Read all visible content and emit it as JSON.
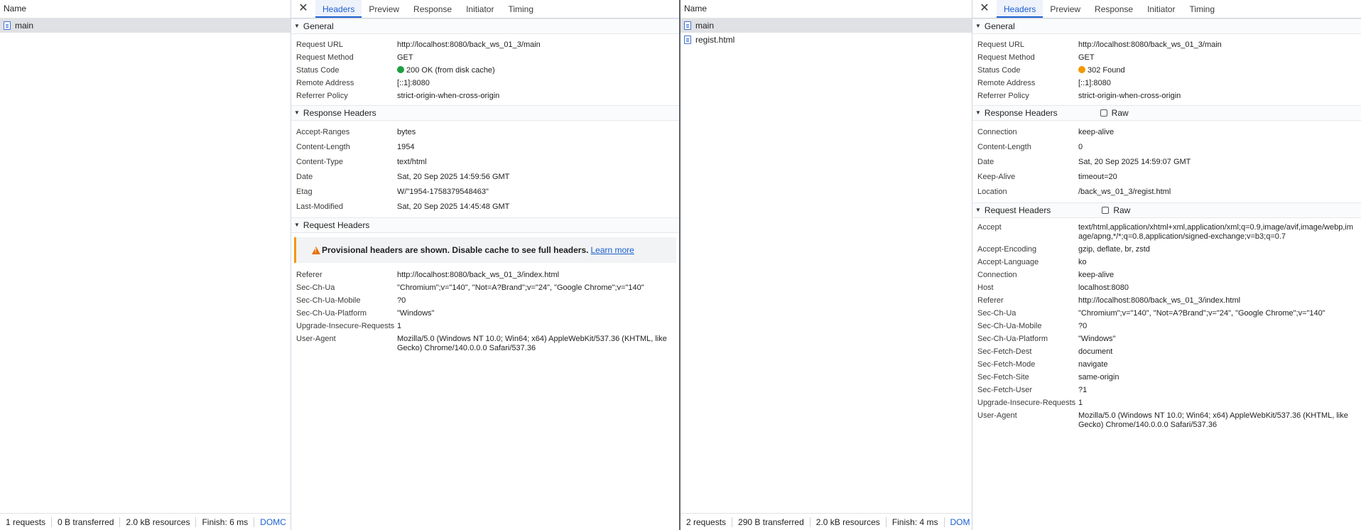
{
  "left": {
    "list_header": "Name",
    "items": [
      "main"
    ],
    "status": [
      "1 requests",
      "0 B transferred",
      "2.0 kB resources",
      "Finish: 6 ms",
      "DOMC"
    ],
    "tabs": [
      "Headers",
      "Preview",
      "Response",
      "Initiator",
      "Timing"
    ],
    "general": {
      "title": "General",
      "rows": [
        {
          "k": "Request URL",
          "v": "http://localhost:8080/back_ws_01_3/main"
        },
        {
          "k": "Request Method",
          "v": "GET"
        },
        {
          "k": "Status Code",
          "v": "200 OK (from disk cache)"
        },
        {
          "k": "Remote Address",
          "v": "[::1]:8080"
        },
        {
          "k": "Referrer Policy",
          "v": "strict-origin-when-cross-origin"
        }
      ]
    },
    "response_headers": {
      "title": "Response Headers",
      "rows": [
        {
          "k": "Accept-Ranges",
          "v": "bytes"
        },
        {
          "k": "Content-Length",
          "v": "1954"
        },
        {
          "k": "Content-Type",
          "v": "text/html"
        },
        {
          "k": "Date",
          "v": "Sat, 20 Sep 2025 14:59:56 GMT"
        },
        {
          "k": "Etag",
          "v": "W/\"1954-1758379548463\""
        },
        {
          "k": "Last-Modified",
          "v": "Sat, 20 Sep 2025 14:45:48 GMT"
        }
      ]
    },
    "request_headers": {
      "title": "Request Headers",
      "warning": "Provisional headers are shown. Disable cache to see full headers.",
      "learn_more": "Learn more",
      "rows": [
        {
          "k": "Referer",
          "v": "http://localhost:8080/back_ws_01_3/index.html"
        },
        {
          "k": "Sec-Ch-Ua",
          "v": "\"Chromium\";v=\"140\", \"Not=A?Brand\";v=\"24\", \"Google Chrome\";v=\"140\""
        },
        {
          "k": "Sec-Ch-Ua-Mobile",
          "v": "?0"
        },
        {
          "k": "Sec-Ch-Ua-Platform",
          "v": "\"Windows\""
        },
        {
          "k": "Upgrade-Insecure-Requests",
          "v": "1"
        },
        {
          "k": "User-Agent",
          "v": "Mozilla/5.0 (Windows NT 10.0; Win64; x64) AppleWebKit/537.36 (KHTML, like Gecko) Chrome/140.0.0.0 Safari/537.36"
        }
      ]
    }
  },
  "right": {
    "list_header": "Name",
    "items": [
      "main",
      "regist.html"
    ],
    "status": [
      "2 requests",
      "290 B transferred",
      "2.0 kB resources",
      "Finish: 4 ms",
      "DOM"
    ],
    "tabs": [
      "Headers",
      "Preview",
      "Response",
      "Initiator",
      "Timing"
    ],
    "general": {
      "title": "General",
      "rows": [
        {
          "k": "Request URL",
          "v": "http://localhost:8080/back_ws_01_3/main"
        },
        {
          "k": "Request Method",
          "v": "GET"
        },
        {
          "k": "Status Code",
          "v": "302 Found"
        },
        {
          "k": "Remote Address",
          "v": "[::1]:8080"
        },
        {
          "k": "Referrer Policy",
          "v": "strict-origin-when-cross-origin"
        }
      ]
    },
    "response_headers": {
      "title": "Response Headers",
      "raw_label": "Raw",
      "rows": [
        {
          "k": "Connection",
          "v": "keep-alive"
        },
        {
          "k": "Content-Length",
          "v": "0"
        },
        {
          "k": "Date",
          "v": "Sat, 20 Sep 2025 14:59:07 GMT"
        },
        {
          "k": "Keep-Alive",
          "v": "timeout=20"
        },
        {
          "k": "Location",
          "v": "/back_ws_01_3/regist.html"
        }
      ]
    },
    "request_headers": {
      "title": "Request Headers",
      "raw_label": "Raw",
      "rows": [
        {
          "k": "Accept",
          "v": "text/html,application/xhtml+xml,application/xml;q=0.9,image/avif,image/webp,image/apng,*/*;q=0.8,application/signed-exchange;v=b3;q=0.7"
        },
        {
          "k": "Accept-Encoding",
          "v": "gzip, deflate, br, zstd"
        },
        {
          "k": "Accept-Language",
          "v": "ko"
        },
        {
          "k": "Connection",
          "v": "keep-alive"
        },
        {
          "k": "Host",
          "v": "localhost:8080"
        },
        {
          "k": "Referer",
          "v": "http://localhost:8080/back_ws_01_3/index.html"
        },
        {
          "k": "Sec-Ch-Ua",
          "v": "\"Chromium\";v=\"140\", \"Not=A?Brand\";v=\"24\", \"Google Chrome\";v=\"140\""
        },
        {
          "k": "Sec-Ch-Ua-Mobile",
          "v": "?0"
        },
        {
          "k": "Sec-Ch-Ua-Platform",
          "v": "\"Windows\""
        },
        {
          "k": "Sec-Fetch-Dest",
          "v": "document"
        },
        {
          "k": "Sec-Fetch-Mode",
          "v": "navigate"
        },
        {
          "k": "Sec-Fetch-Site",
          "v": "same-origin"
        },
        {
          "k": "Sec-Fetch-User",
          "v": "?1"
        },
        {
          "k": "Upgrade-Insecure-Requests",
          "v": "1"
        },
        {
          "k": "User-Agent",
          "v": "Mozilla/5.0 (Windows NT 10.0; Win64; x64) AppleWebKit/537.36 (KHTML, like Gecko) Chrome/140.0.0.0 Safari/537.36"
        }
      ]
    }
  }
}
